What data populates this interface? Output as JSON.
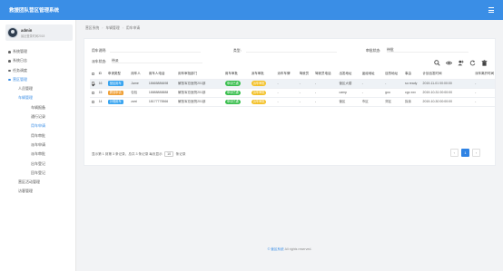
{
  "app": {
    "title": "救援团队营区管理系统"
  },
  "user": {
    "name": "admin",
    "last_login": "最近登录时间2018"
  },
  "sidebar": {
    "items": [
      {
        "label": "系统管理",
        "level": 0
      },
      {
        "label": "系统日志",
        "level": 0
      },
      {
        "label": "任务调度",
        "level": 0
      },
      {
        "label": "营区管理",
        "level": 0,
        "active": true
      },
      {
        "label": "人员管理",
        "level": 1
      },
      {
        "label": "车辆管理",
        "level": 1,
        "active": true
      },
      {
        "label": "车辆报备",
        "level": 2
      },
      {
        "label": "通行记录",
        "level": 2
      },
      {
        "label": "用车申请",
        "level": 2,
        "active": true
      },
      {
        "label": "用车审批",
        "level": 2
      },
      {
        "label": "派车申请",
        "level": 2
      },
      {
        "label": "派车审批",
        "level": 2
      },
      {
        "label": "出车登记",
        "level": 2
      },
      {
        "label": "回车登记",
        "level": 2
      },
      {
        "label": "营区活动管理",
        "level": 1
      },
      {
        "label": "访客管理",
        "level": 1
      }
    ]
  },
  "breadcrumb": [
    "营区系统",
    "车辆管理",
    "用车申请"
  ],
  "filters": {
    "applicant_label": "用车说明:",
    "applicant_value": "",
    "type_label": "类型:",
    "type_value": "",
    "approval_label": "审批状态:",
    "approval_value": "待批",
    "dispatch_label": "派车状态:",
    "dispatch_value": "待派"
  },
  "toolbar": {
    "icons": [
      "search-icon",
      "eye-icon",
      "add-user-icon",
      "refresh-icon",
      "trash-icon"
    ]
  },
  "table": {
    "columns": [
      "",
      "ID",
      "申请类型",
      "用车人",
      "用车人电话",
      "用车审批部门",
      "用车审批",
      "派车审批",
      "派车车牌",
      "驾驶员",
      "驾驶员电话",
      "出发地址",
      "途经地址",
      "目的地址",
      "事由",
      "计划出发时间",
      "派车离开时间",
      "计划"
    ],
    "rows": [
      {
        "checked": true,
        "id": "16",
        "type": "营区用车",
        "type_color": "blue",
        "person": "Jame",
        "phone": "18665886698",
        "dept": "解放军总医院201部",
        "approval": "申请已通",
        "approval_color": "green",
        "dispatch": "派车审批",
        "dispatch_color": "yellow",
        "plate": "-",
        "driver": "-",
        "driver_phone": "-",
        "from": "营区大楼",
        "via": "-",
        "to": "-",
        "reason": "so ready",
        "plan_start": "2019-11-01 00:00:00",
        "leave": "-",
        "plan": "20"
      },
      {
        "checked": false,
        "id": "15",
        "type": "跨省申请",
        "type_color": "orange",
        "person": "包包",
        "phone": "18888888888",
        "dept": "解放军总医院201部",
        "approval": "申请已通",
        "approval_color": "green",
        "dispatch": "派车审批",
        "dispatch_color": "yellow",
        "plate": "-",
        "driver": "-",
        "driver_phone": "-",
        "from": "camp",
        "via": "-",
        "to": "gou",
        "reason": "cgo xxx",
        "plan_start": "2019-10-31 00:00:00",
        "leave": "-",
        "plan": "20"
      },
      {
        "checked": false,
        "id": "14",
        "type": "计程用车",
        "type_color": "blue",
        "person": "zwxi",
        "phone": "18177775566",
        "dept": "解放军总医院201部",
        "approval": "申请已通",
        "approval_color": "green",
        "dispatch": "派车审批",
        "dispatch_color": "yellow",
        "plate": "-",
        "driver": "-",
        "driver_phone": "-",
        "from": "营区",
        "via": "市区",
        "to": "郊区",
        "reason": "探亲",
        "plan_start": "2019-10-30 00:00:00",
        "leave": "-",
        "plan": "20"
      }
    ]
  },
  "pagination": {
    "info_prefix": "显示第 1 到第 3 条记录，总共 3 条记录 每页显示",
    "page_size": "10",
    "info_suffix": "条记录",
    "prev": "‹",
    "current": "1",
    "next": "›"
  },
  "footer": {
    "brand": "© 营区系统",
    "text": "All rights reserved."
  }
}
